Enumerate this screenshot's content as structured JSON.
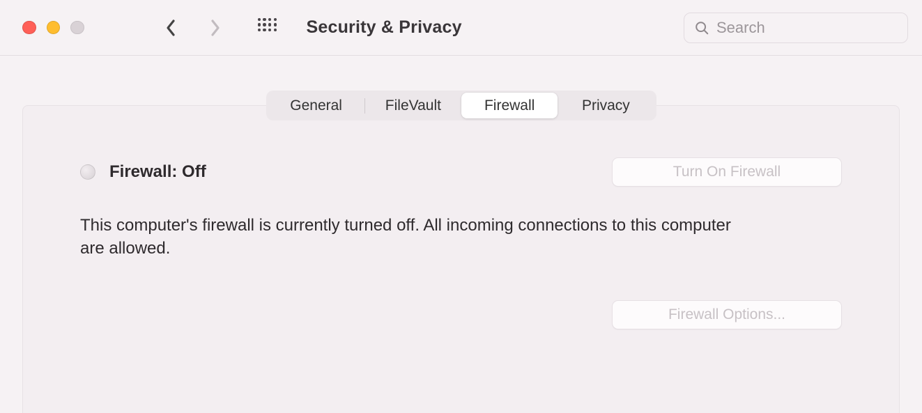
{
  "window": {
    "title": "Security & Privacy"
  },
  "search": {
    "placeholder": "Search"
  },
  "tabs": {
    "items": [
      {
        "label": "General"
      },
      {
        "label": "FileVault"
      },
      {
        "label": "Firewall"
      },
      {
        "label": "Privacy"
      }
    ],
    "active_index": 2
  },
  "firewall": {
    "status_label": "Firewall: Off",
    "turn_on_label": "Turn On Firewall",
    "description": "This computer's firewall is currently turned off. All incoming connections to this computer are allowed.",
    "options_label": "Firewall Options..."
  }
}
